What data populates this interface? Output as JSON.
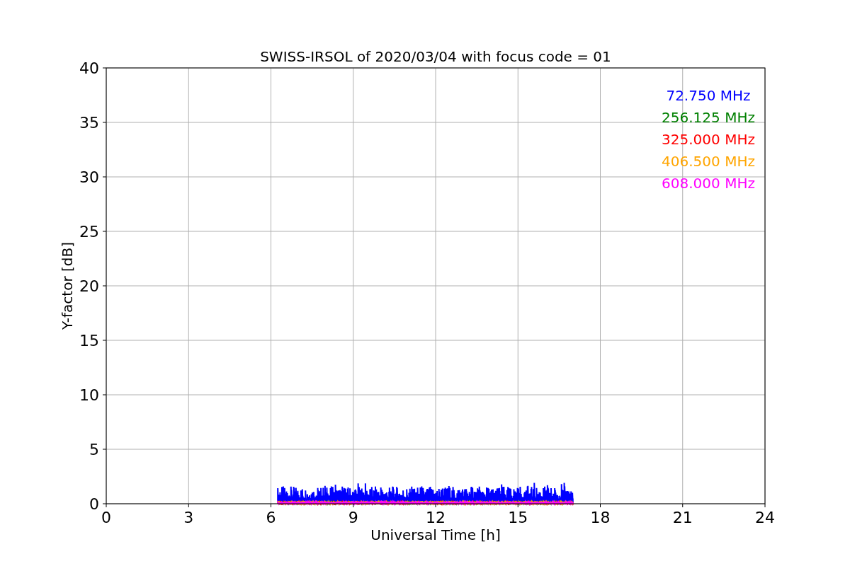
{
  "figure": {
    "title": "SWISS-IRSOL of 2020/03/04 with focus code = 01",
    "xlabel": "Universal Time [h]",
    "ylabel": "Y-factor [dB]",
    "x_tick_labels": [
      "0",
      "3",
      "6",
      "9",
      "12",
      "15",
      "18",
      "21",
      "24"
    ],
    "y_tick_labels": [
      "40",
      "35",
      "30",
      "25",
      "20",
      "15",
      "10",
      "5",
      "0"
    ],
    "legend": [
      {
        "name": "72.750 MHz",
        "color": "#0000ff"
      },
      {
        "name": "256.125 MHz",
        "color": "#008000"
      },
      {
        "name": "325.000 MHz",
        "color": "#ff0000"
      },
      {
        "name": "406.500 MHz",
        "color": "#ffa500"
      },
      {
        "name": "608.000 MHz",
        "color": "#ff00ff"
      }
    ]
  }
}
